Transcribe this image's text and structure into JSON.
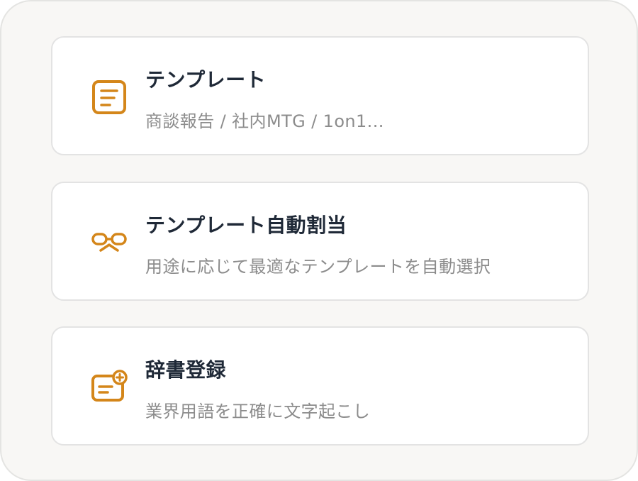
{
  "features": [
    {
      "icon": "document-lines-icon",
      "title": "テンプレート",
      "subtitle": "商談報告 / 社内MTG / 1on1..."
    },
    {
      "icon": "glasses-mustache-icon",
      "title": "テンプレート自動割当",
      "subtitle": "用途に応じて最適なテンプレートを自動選択"
    },
    {
      "icon": "card-add-icon",
      "title": "辞書登録",
      "subtitle": "業界用語を正確に文字起こし"
    }
  ],
  "colors": {
    "accent": "#d4861a",
    "title": "#1f2937",
    "subtitle": "#8c8c8c",
    "panel_bg": "#f8f7f5",
    "card_border": "#e3e3e3"
  }
}
